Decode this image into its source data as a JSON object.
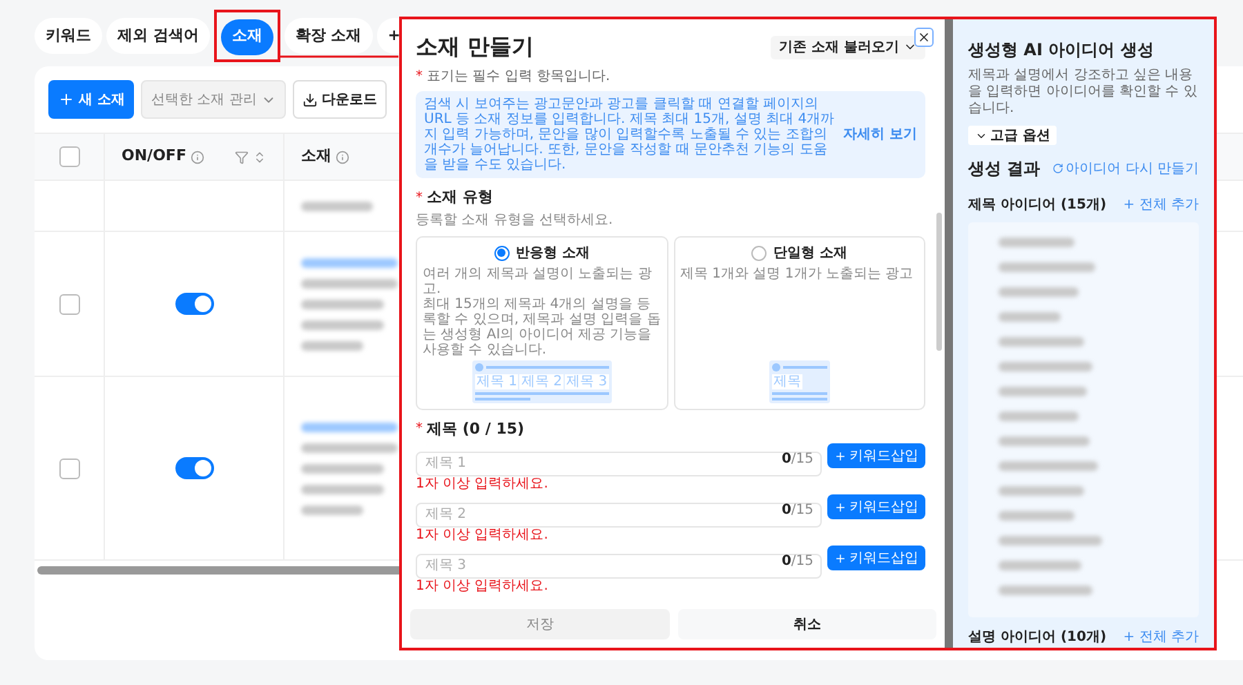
{
  "tabs": [
    {
      "label": "키워드",
      "selected": false
    },
    {
      "label": "제외 검색어",
      "selected": false
    },
    {
      "label": "소재",
      "selected": true
    },
    {
      "label": "확장 소재",
      "selected": false
    },
    {
      "label": "+",
      "selected": false
    }
  ],
  "toolbar": {
    "new_button": "새 소재",
    "manage_dropdown": "선택한 소재 관리",
    "download_button": "다운로드"
  },
  "table": {
    "header_checked": false,
    "columns": [
      {
        "label": "ON/OFF"
      },
      {
        "label": "소재"
      }
    ],
    "rows": [
      {
        "kind": "summary"
      },
      {
        "kind": "item",
        "checked": false,
        "on": true
      },
      {
        "kind": "item",
        "checked": false,
        "on": true
      }
    ]
  },
  "modal": {
    "title": "소재 만들기",
    "load_dropdown": "기존 소재 불러오기",
    "required_mark": "*",
    "required_note": "표기는 필수 입력 항목입니다.",
    "info": "검색 시 보여주는 광고문안과 광고를 클릭할 때 연결할 페이지의 URL 등 소재 정보를 입력합니다. 제목 최대 15개, 설명 최대 4개까지 입력 가능하며, 문안을 많이 입력할수록 노출될 수 있는 조합의 개수가 늘어납니다. 또한, 문안을 작성할 때 문안추천 기능의 도움을 받을 수도 있습니다.",
    "info_link": "자세히 보기",
    "type_section": {
      "required_mark": "*",
      "title": "소재 유형",
      "subtitle": "등록할 소재 유형을 선택하세요.",
      "options": [
        {
          "label": "반응형 소재",
          "selected": true,
          "description": "여러 개의 제목과 설명이 노출되는 광고.\n최대 15개의 제목과 4개의 설명을 등록할 수 있으며, 제목과 설명 입력을 돕는 생성형 AI의 아이디어 제공 기능을 사용할 수 있습니다.",
          "chips": [
            "제목 1",
            "제목 2",
            "제목 3"
          ]
        },
        {
          "label": "단일형 소재",
          "selected": false,
          "description": "제목 1개와 설명 1개가 노출되는 광고",
          "chips": [
            "제목"
          ]
        }
      ]
    },
    "titles_section": {
      "required_mark": "*",
      "title": "제목 (0 / 15)",
      "fields": [
        {
          "placeholder": "제목 1",
          "count": "0",
          "max": "/15",
          "button": "키워드삽입",
          "error": "1자 이상 입력하세요."
        },
        {
          "placeholder": "제목 2",
          "count": "0",
          "max": "/15",
          "button": "키워드삽입",
          "error": "1자 이상 입력하세요."
        },
        {
          "placeholder": "제목 3",
          "count": "0",
          "max": "/15",
          "button": "키워드삽입",
          "error": "1자 이상 입력하세요."
        }
      ]
    },
    "footer": {
      "save_button": "저장",
      "cancel_button": "취소"
    }
  },
  "ai_panel": {
    "title": "생성형 AI 아이디어 생성",
    "description": "제목과 설명에서 강조하고 싶은 내용을 입력하면 아이디어를 확인할 수 있습니다.",
    "options_button": "고급 옵션",
    "results_title": "생성 결과",
    "regenerate_link": "아이디어 다시 만들기",
    "title_ideas": {
      "label": "제목 아이디어 (15개)",
      "add_all": "+ 전체 추가"
    },
    "description_ideas": {
      "label": "설명 아이디어 (10개)",
      "add_all": "+ 전체 추가"
    }
  }
}
